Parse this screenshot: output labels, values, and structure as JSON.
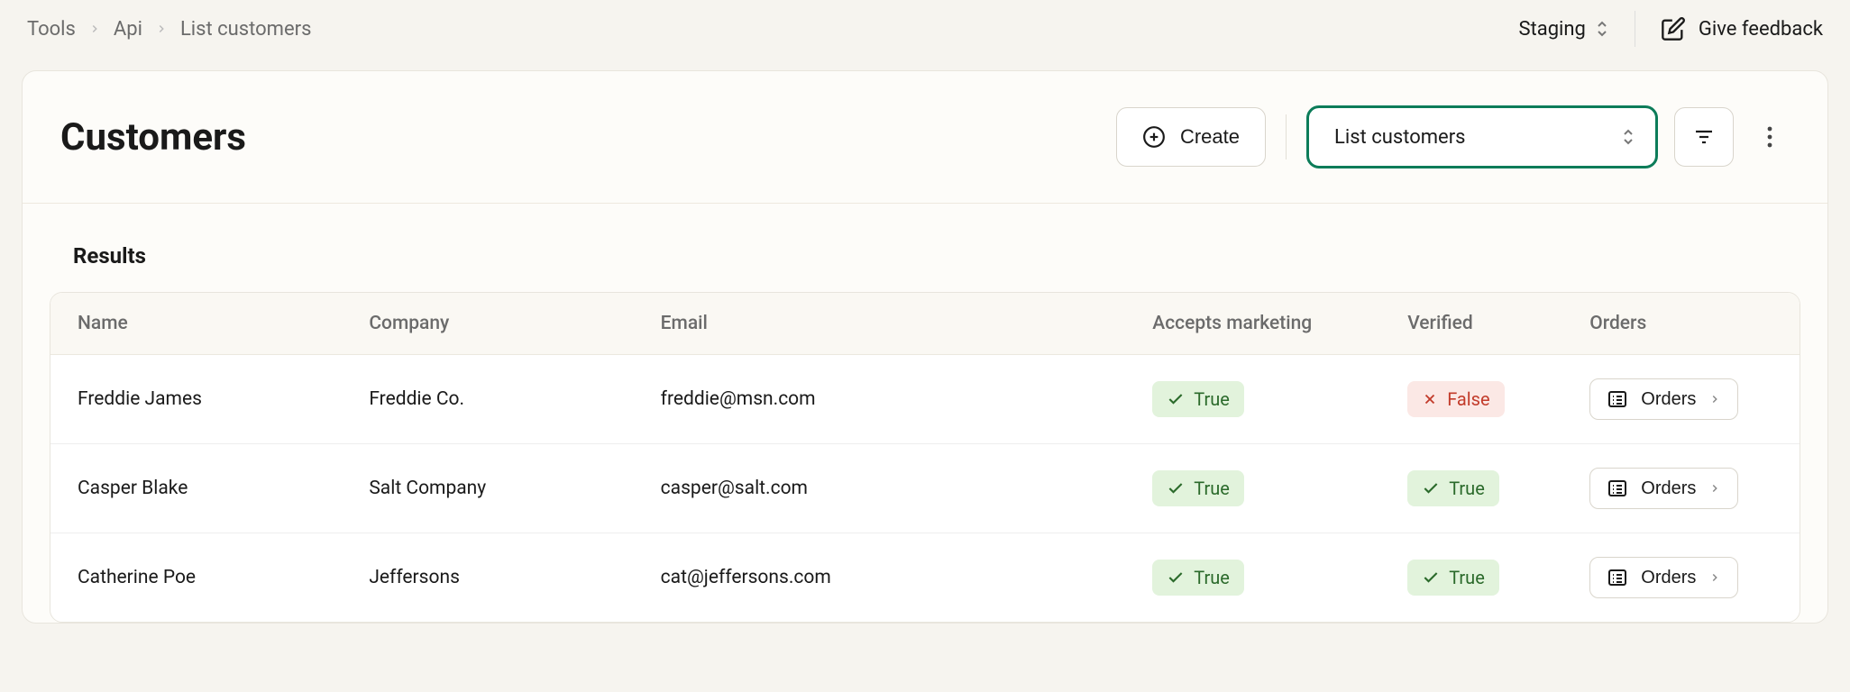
{
  "breadcrumb": {
    "items": [
      "Tools",
      "Api",
      "List customers"
    ]
  },
  "topbar": {
    "environment": "Staging",
    "feedback_label": "Give feedback"
  },
  "header": {
    "title": "Customers",
    "create_label": "Create",
    "view_selected": "List customers"
  },
  "results": {
    "title": "Results",
    "columns": {
      "name": "Name",
      "company": "Company",
      "email": "Email",
      "marketing": "Accepts marketing",
      "verified": "Verified",
      "orders": "Orders"
    },
    "badge_true": "True",
    "badge_false": "False",
    "orders_button": "Orders",
    "rows": [
      {
        "name": "Freddie James",
        "company": "Freddie Co.",
        "email": "freddie@msn.com",
        "accepts_marketing": true,
        "verified": false
      },
      {
        "name": "Casper Blake",
        "company": "Salt Company",
        "email": "casper@salt.com",
        "accepts_marketing": true,
        "verified": true
      },
      {
        "name": "Catherine Poe",
        "company": "Jeffersons",
        "email": "cat@jeffersons.com",
        "accepts_marketing": true,
        "verified": true
      }
    ]
  }
}
